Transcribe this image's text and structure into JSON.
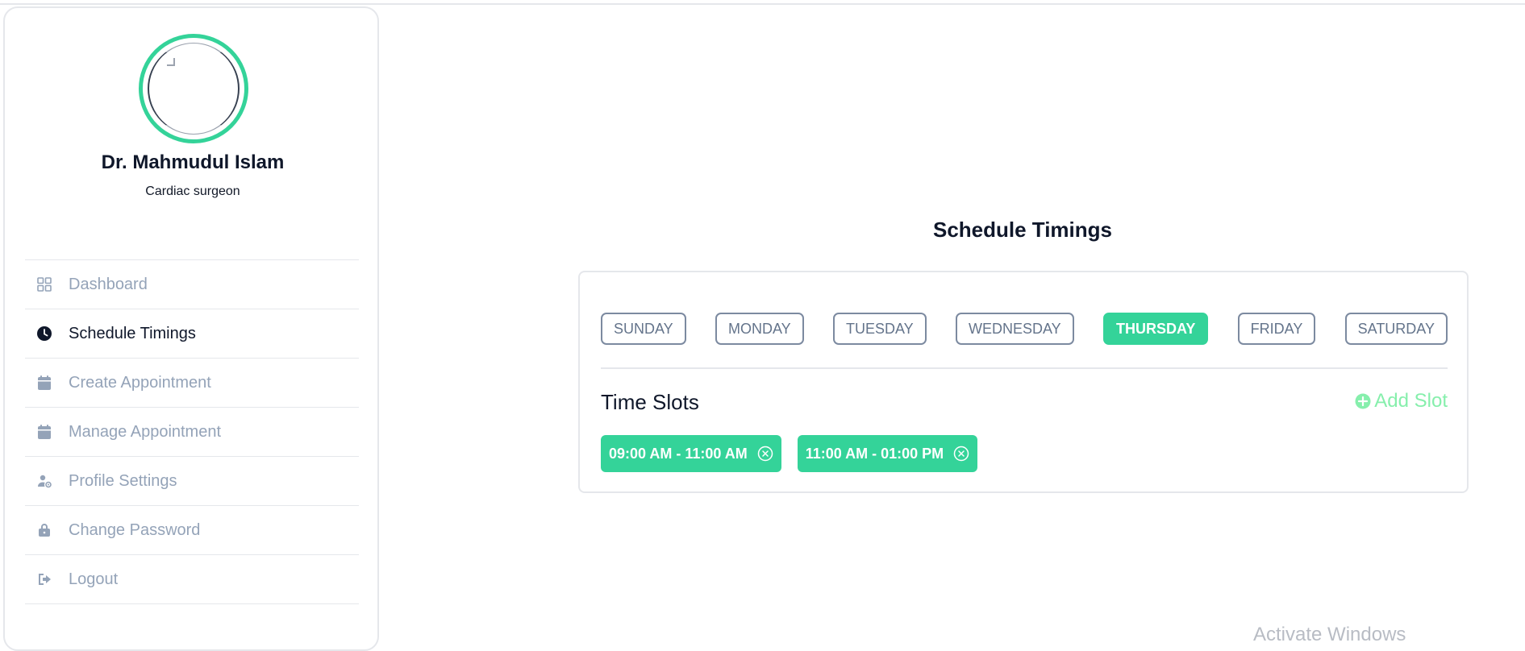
{
  "profile": {
    "name": "Dr. Mahmudul Islam",
    "specialty": "Cardiac surgeon"
  },
  "sidebar": {
    "items": [
      {
        "label": "Dashboard",
        "icon": "grid-icon",
        "active": false
      },
      {
        "label": "Schedule Timings",
        "icon": "clock-icon",
        "active": true
      },
      {
        "label": "Create Appointment",
        "icon": "calendar-icon",
        "active": false
      },
      {
        "label": "Manage Appointment",
        "icon": "calendar-icon",
        "active": false
      },
      {
        "label": "Profile Settings",
        "icon": "user-cog-icon",
        "active": false
      },
      {
        "label": "Change Password",
        "icon": "lock-icon",
        "active": false
      },
      {
        "label": "Logout",
        "icon": "logout-icon",
        "active": false
      }
    ]
  },
  "main": {
    "title": "Schedule Timings",
    "days": [
      "SUNDAY",
      "MONDAY",
      "TUESDAY",
      "WEDNESDAY",
      "THURSDAY",
      "FRIDAY",
      "SATURDAY"
    ],
    "selected_day": "THURSDAY",
    "slots_title": "Time Slots",
    "add_slot_label": "Add Slot",
    "slots": [
      "09:00 AM - 11:00 AM",
      "11:00 AM - 01:00 PM"
    ]
  },
  "watermark": "Activate Windows",
  "colors": {
    "accent": "#34d399",
    "accent_light": "#86efac",
    "muted_text": "#94a3b8",
    "border": "#e5e7eb"
  }
}
